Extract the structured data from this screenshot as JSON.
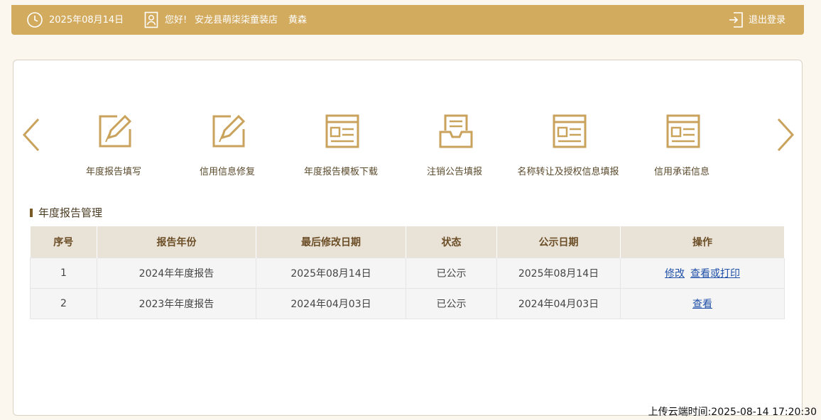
{
  "header": {
    "date": "2025年08月14日",
    "greeting": "您好!",
    "shop_name": "安龙县萌柒柒童装店",
    "user_name": "黄森",
    "logout_label": "退出登录"
  },
  "menu": {
    "items": [
      {
        "label": "年度报告填写",
        "icon": "edit-icon"
      },
      {
        "label": "信用信息修复",
        "icon": "edit-icon"
      },
      {
        "label": "年度报告模板下载",
        "icon": "document-icon"
      },
      {
        "label": "注销公告填报",
        "icon": "inbox-icon"
      },
      {
        "label": "名称转让及授权信息填报",
        "icon": "document-icon"
      },
      {
        "label": "信用承诺信息",
        "icon": "document-icon"
      }
    ]
  },
  "section": {
    "title": "年度报告管理",
    "columns": [
      "序号",
      "报告年份",
      "最后修改日期",
      "状态",
      "公示日期",
      "操作"
    ],
    "rows": [
      {
        "index": "1",
        "year": "2024年年度报告",
        "modified": "2025年08月14日",
        "status": "已公示",
        "publish_date": "2025年08月14日",
        "actions": [
          "修改",
          "查看或打印"
        ]
      },
      {
        "index": "2",
        "year": "2023年年度报告",
        "modified": "2024年04月03日",
        "status": "已公示",
        "publish_date": "2024年04月03日",
        "actions": [
          "查看"
        ]
      }
    ]
  },
  "upload_time": "上传云端时间:2025-08-14 17:20:30",
  "colors": {
    "accent": "#d3ab5f",
    "page_bg": "#fbf7ef",
    "link": "#1f4fa8"
  }
}
